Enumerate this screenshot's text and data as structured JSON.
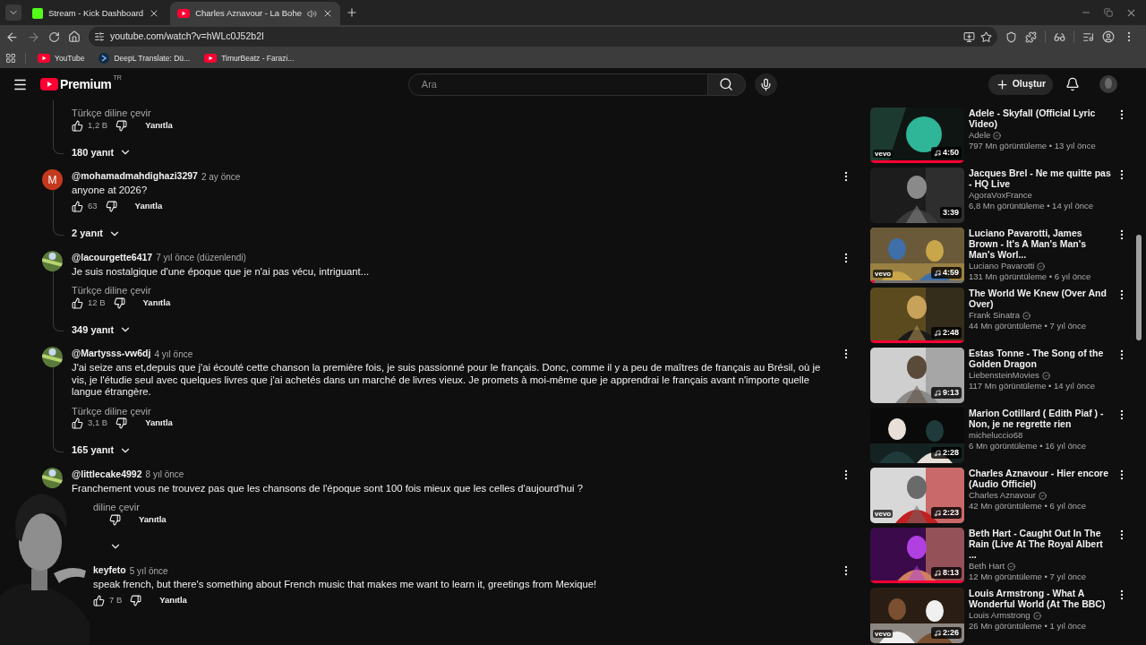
{
  "browser": {
    "tabs": [
      {
        "title": "Stream - Kick Dashboard",
        "selected": false,
        "kind": "kick",
        "audio": false
      },
      {
        "title": "Charles Aznavour - La Bohe",
        "selected": true,
        "kind": "youtube",
        "audio": true
      }
    ],
    "url": "youtube.com/watch?v=hWLc0J52b2I",
    "bookmarks": [
      {
        "label": "YouTube",
        "kind": "youtube"
      },
      {
        "label": "DeepL Translate: Dü...",
        "kind": "deepl"
      },
      {
        "label": "TimurBeatz - Farazi...",
        "kind": "youtube"
      }
    ]
  },
  "header": {
    "logo": "Premium",
    "region": "TR",
    "search_placeholder": "Ara",
    "create": "Oluştur"
  },
  "comments": [
    {
      "translate": "Türkçe diline çevir",
      "likes": "1,2 B",
      "reply": "Yanıtla",
      "has_replies": true,
      "replies": "180 yanıt"
    },
    {
      "author": "@mohamadmahdighazi3297",
      "time": "2 ay önce",
      "avatar": {
        "kind": "letter",
        "letter": "M",
        "color": "#c4391d"
      },
      "text": "anyone at 2026?",
      "likes": "63",
      "reply": "Yanıtla",
      "has_replies": true,
      "replies": "2 yanıt"
    },
    {
      "author": "@lacourgette6417",
      "time": "7 yıl önce (düzenlendi)",
      "text": "Je suis nostalgique d'une époque que je n'ai pas vécu, intriguant...",
      "translate": "Türkçe diline çevir",
      "likes": "12 B",
      "reply": "Yanıtla",
      "has_replies": true,
      "replies": "349 yanıt"
    },
    {
      "author": "@Martysss-vw6dj",
      "time": "4 yıl önce",
      "text": "J'ai seize ans et,depuis que j'ai écouté cette chanson la première fois, je suis passionné pour le français. Donc, comme il y a peu de maîtres de français au Brésil, où je vis, je l'étudie seul avec quelques livres que j'ai achetés dans un marché de livres vieux. Je promets à moi-même que je apprendrai le français avant n'importe quelle langue étrangère.",
      "translate": "Türkçe diline çevir",
      "likes": "3,1 B",
      "reply": "Yanıtla",
      "has_replies": true,
      "replies": "165 yanıt"
    },
    {
      "author": "@littlecake4992",
      "time": "8 yıl önce",
      "text": "Franchement vous ne trouvez pas que les chansons de l'époque sont 100 fois mieux que les celles d'aujourd'hui ?",
      "translate": "diline çevir",
      "reply": "Yanıtla",
      "has_replies": true,
      "kind": "partly_hidden"
    },
    {
      "author": "keyfeto",
      "time": "5 yıl önce",
      "text": "speak french, but there's something about French music that makes me want to learn it, greetings from Mexique!",
      "likes": "7 B",
      "reply": "Yanıtla",
      "has_replies": false,
      "kind": "hidden_start"
    }
  ],
  "videos": [
    {
      "title": "Adele - Skyfall (Official Lyric Video)",
      "channel": "Adele",
      "verified": true,
      "meta": "797 Mn görüntüleme • 13 yıl önce",
      "duration": "4:50",
      "music": true,
      "badge": "vevo",
      "level": 1,
      "highlighted": false
    },
    {
      "title": "Jacques Brel - Ne me quitte pas - HQ Live",
      "channel": "AgoraVoxFrance",
      "verified": false,
      "meta": "6,8 Mn görüntüleme • 14 yıl önce",
      "duration": "3:39",
      "music": false,
      "highlighted": false
    },
    {
      "title": "Luciano Pavarotti, James Brown - It's A Man's Man's Man's Worl...",
      "channel": "Luciano Pavarotti",
      "verified": true,
      "meta": "131 Mn görüntüleme • 6 yıl önce",
      "duration": "4:59",
      "music": true,
      "badge": "vevo",
      "level": 0.05,
      "highlighted": true
    },
    {
      "title": "The World We Knew (Over And Over)",
      "channel": "Frank Sinatra",
      "verified": true,
      "meta": "44 Mn görüntüleme • 7 yıl önce",
      "duration": "2:48",
      "music": true,
      "level": 1,
      "highlighted": false
    },
    {
      "title": "Estas Tonne - The Song of the Golden Dragon",
      "channel": "LiebensteinMovies",
      "verified": true,
      "meta": "117 Mn görüntüleme • 14 yıl önce",
      "duration": "9:13",
      "music": true,
      "highlighted": false
    },
    {
      "title": "Marion Cotillard ( Edith Piaf ) - Non, je ne regrette rien",
      "channel": "micheluccio68",
      "verified": false,
      "meta": "6 Mn görüntüleme • 16 yıl önce",
      "duration": "2:28",
      "music": true,
      "highlighted": false
    },
    {
      "title": "Charles Aznavour - Hier encore (Audio Officiel)",
      "channel": "Charles Aznavour",
      "verified": true,
      "meta": "42 Mn görüntüleme • 6 yıl önce",
      "duration": "2:23",
      "music": true,
      "badge": "vevo",
      "highlighted": false
    },
    {
      "title": "Beth Hart - Caught Out In The Rain (Live At The Royal Albert ...",
      "channel": "Beth Hart",
      "verified": true,
      "meta": "12 Mn görüntüleme • 7 yıl önce",
      "duration": "8:13",
      "music": true,
      "level": 1,
      "highlighted": false
    },
    {
      "title": "Louis Armstrong - What A Wonderful World (At The BBC)",
      "channel": "Louis Armstrong",
      "verified": true,
      "meta": "26 Mn görüntüleme • 1 yıl önce",
      "duration": "2:26",
      "music": true,
      "badge": "vevo",
      "highlighted": false
    }
  ]
}
